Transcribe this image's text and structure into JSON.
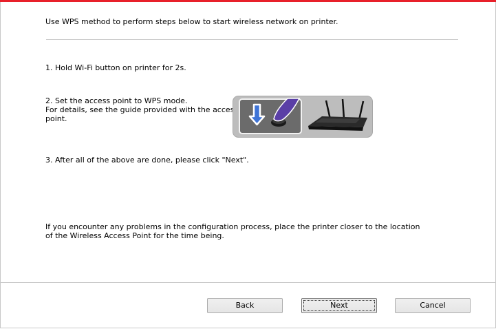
{
  "colors": {
    "accent_bar": "#e8202a",
    "background": "#ffffff",
    "divider": "#c8c8c8"
  },
  "main": {
    "intro": "Use WPS method to perform steps below to start wireless network on printer.",
    "step1": "1. Hold Wi-Fi button on printer for 2s.",
    "step2_line1": "2. Set the access point to WPS mode.",
    "step2_line2": "For details, see the guide provided with the access",
    "step2_line3": "point.",
    "step3": "3. After all of the above are done, please click \"Next\".",
    "note_line1": "If you encounter any problems in the configuration process, place the printer closer to the location",
    "note_line2": "of the Wireless Access Point for the time being."
  },
  "illustration": {
    "icons": [
      "down-arrow-icon",
      "finger-press-icon",
      "wireless-router-icon"
    ]
  },
  "buttons": {
    "back": "Back",
    "next": "Next",
    "cancel": "Cancel"
  }
}
